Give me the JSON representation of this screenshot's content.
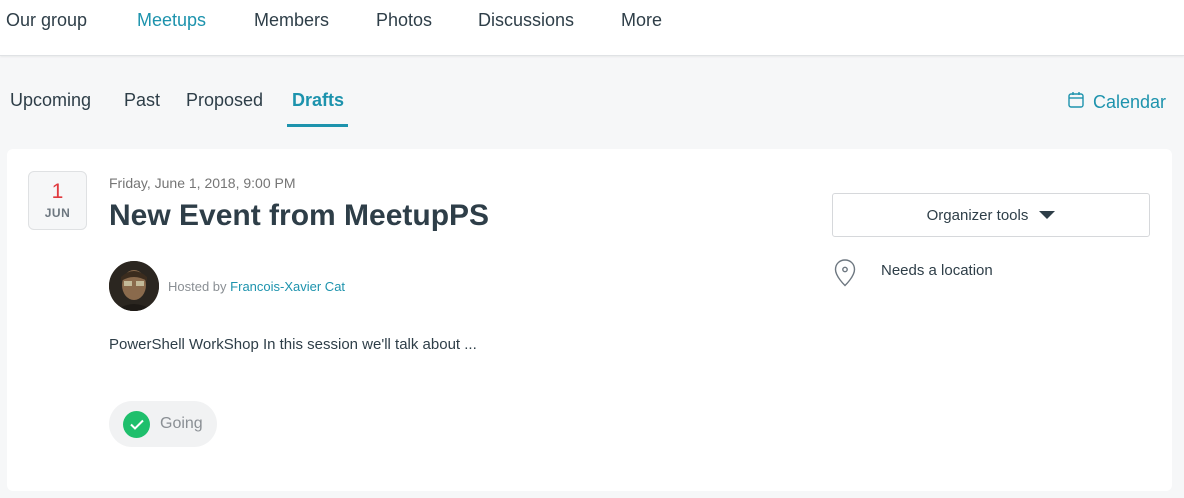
{
  "top_nav": {
    "items": [
      {
        "label": "Our group"
      },
      {
        "label": "Meetups"
      },
      {
        "label": "Members"
      },
      {
        "label": "Photos"
      },
      {
        "label": "Discussions"
      },
      {
        "label": "More"
      }
    ],
    "active": "Meetups"
  },
  "sub_tabs": {
    "items": [
      {
        "label": "Upcoming"
      },
      {
        "label": "Past"
      },
      {
        "label": "Proposed"
      },
      {
        "label": "Drafts"
      }
    ],
    "active": "Drafts"
  },
  "calendar_link": {
    "label": "Calendar",
    "icon": "calendar-icon"
  },
  "event": {
    "date_day": "1",
    "date_month": "JUN",
    "datetime": "Friday, June 1, 2018, 9:00 PM",
    "title": "New Event from MeetupPS",
    "hosted_by_prefix": "Hosted by",
    "host_name": "Francois-Xavier Cat",
    "description": "PowerShell WorkShop In this session we'll talk about ...",
    "rsvp_label": "Going",
    "rsvp_icon": "check-icon"
  },
  "sidebar": {
    "organizer_tools_label": "Organizer tools",
    "location_text": "Needs a location",
    "location_icon": "map-pin-icon"
  },
  "colors": {
    "accent": "#1d93ad",
    "date_red": "#e0393e",
    "going_green": "#1fbf6c",
    "text": "#2e3e48",
    "muted": "#757575"
  }
}
